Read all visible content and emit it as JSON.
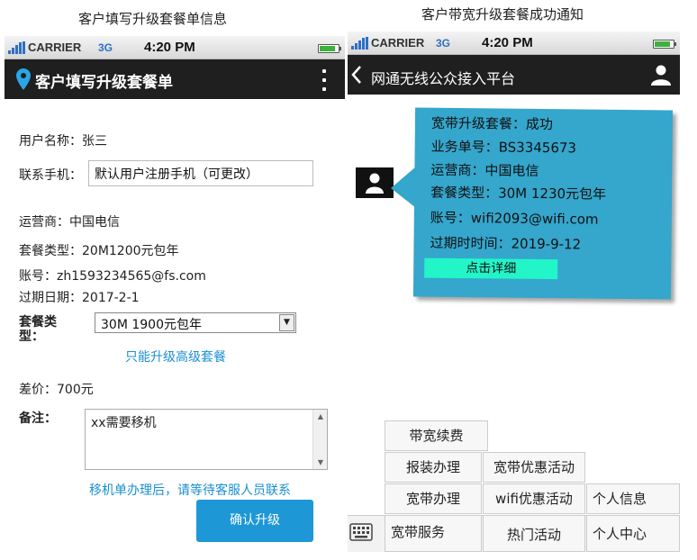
{
  "left": {
    "caption": "客户填写升级套餐单信息",
    "status": {
      "carrier": "CARRIER",
      "network": "3G",
      "time": "4:20 PM"
    },
    "title": "客户填写升级套餐单",
    "form": {
      "username_label": "用户名称：张三",
      "phone_label": "联系手机：",
      "phone_value": "默认用户注册手机（可更改）",
      "operator": "运营商：中国电信",
      "package_type": "套餐类型：20M1200元包年",
      "account": "账号：zh1593234565@fs.com",
      "expiry": "过期日期：2017-2-1",
      "new_package_label_1": "套餐类",
      "new_package_label_2": "型：",
      "new_package_value": "30M 1900元包年",
      "upgrade_hint": "只能升级高级套餐",
      "price_diff": "差价：700元",
      "note_label": "备注：",
      "note_value": "xx需要移机",
      "move_hint": "移机单办理后，请等待客服人员联系",
      "confirm_label": "确认升级"
    }
  },
  "right": {
    "caption": "客户带宽升级套餐成功通知",
    "status": {
      "carrier": "CARRIER",
      "network": "3G",
      "time": "4:20 PM"
    },
    "title": "网通无线公众接入平台",
    "message": {
      "line1": "宽带升级套餐：成功",
      "line2": "业务单号：BS3345673",
      "line3": "运营商：中国电信",
      "line4": "套餐类型：30M 1230元包年",
      "line5": "账号：wifi2093@wifi.com",
      "line6": "过期时时间：2019-9-12",
      "detail_label": "点击详细"
    },
    "menu": {
      "renew": "带宽续费",
      "install": "报装办理",
      "promo": "宽带优惠活动",
      "broadband_service": "宽带办理",
      "wifi_promo": "wifi优惠活动",
      "personal_info": "个人信息",
      "broadband": "宽带服务",
      "hot": "热门活动",
      "personal_center": "个人中心"
    }
  },
  "colors": {
    "accent": "#1d97d6",
    "bubble": "#35a6cc",
    "detail_button": "#22f5c8",
    "titlebar": "#1f1f1f"
  }
}
